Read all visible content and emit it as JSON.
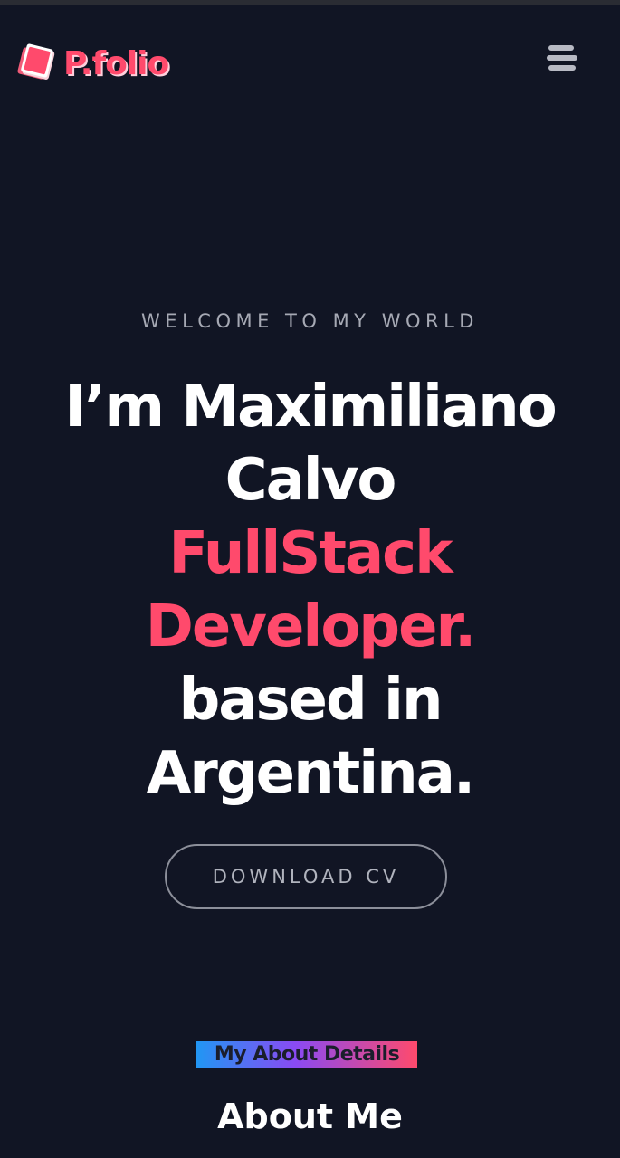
{
  "header": {
    "logo_text": "P.folio",
    "menu_icon": "hamburger-menu-icon",
    "brand_color": "#ff4a6c"
  },
  "hero": {
    "eyebrow": "WELCOME TO MY WORLD",
    "name_line1": "I’m Maximiliano",
    "name_line2": "Calvo",
    "role_line1": "FullStack",
    "role_line2": "Developer.",
    "location_line1": "based in",
    "location_line2": "Argentina.",
    "cv_button_label": "DOWNLOAD CV"
  },
  "about": {
    "tag": "My About Details",
    "title": "About Me"
  },
  "colors": {
    "background": "#111524",
    "accent": "#ff4a6c",
    "muted_text": "#a6a9b4"
  }
}
